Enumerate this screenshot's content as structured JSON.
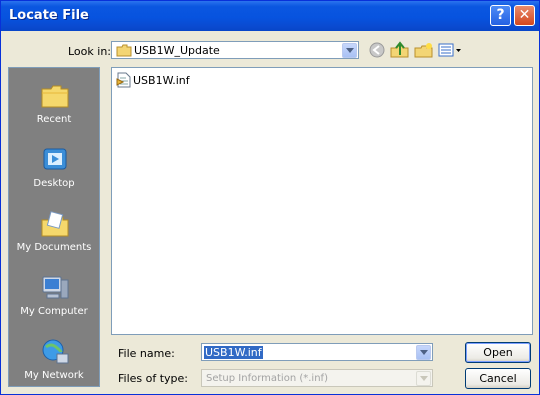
{
  "window": {
    "title": "Locate File"
  },
  "titlebar": {
    "help_label": "?",
    "close_label": "✕"
  },
  "toolbar": {
    "look_in_label": "Look in:",
    "look_in_value": "USB1W_Update",
    "tools": [
      "back-icon",
      "up-folder-icon",
      "new-folder-icon",
      "views-menu-icon"
    ]
  },
  "places_bar": {
    "items": [
      {
        "label": "Recent",
        "icon": "recent-icon"
      },
      {
        "label": "Desktop",
        "icon": "desktop-icon"
      },
      {
        "label": "My Documents",
        "icon": "my-documents-icon"
      },
      {
        "label": "My Computer",
        "icon": "my-computer-icon"
      },
      {
        "label": "My Network",
        "icon": "my-network-icon"
      }
    ]
  },
  "file_list": {
    "items": [
      {
        "name": "USB1W.inf",
        "icon": "setup-info-file-icon"
      }
    ]
  },
  "file_name": {
    "label": "File name:",
    "value": "USB1W.inf"
  },
  "file_type": {
    "label": "Files of type:",
    "value": "Setup Information (*.inf)"
  },
  "buttons": {
    "open": "Open",
    "cancel": "Cancel"
  },
  "colors": {
    "title_bar": "#0a58e0",
    "dialog_bg": "#ece9d8",
    "selection": "#316ac5",
    "places_bg": "#808080"
  }
}
